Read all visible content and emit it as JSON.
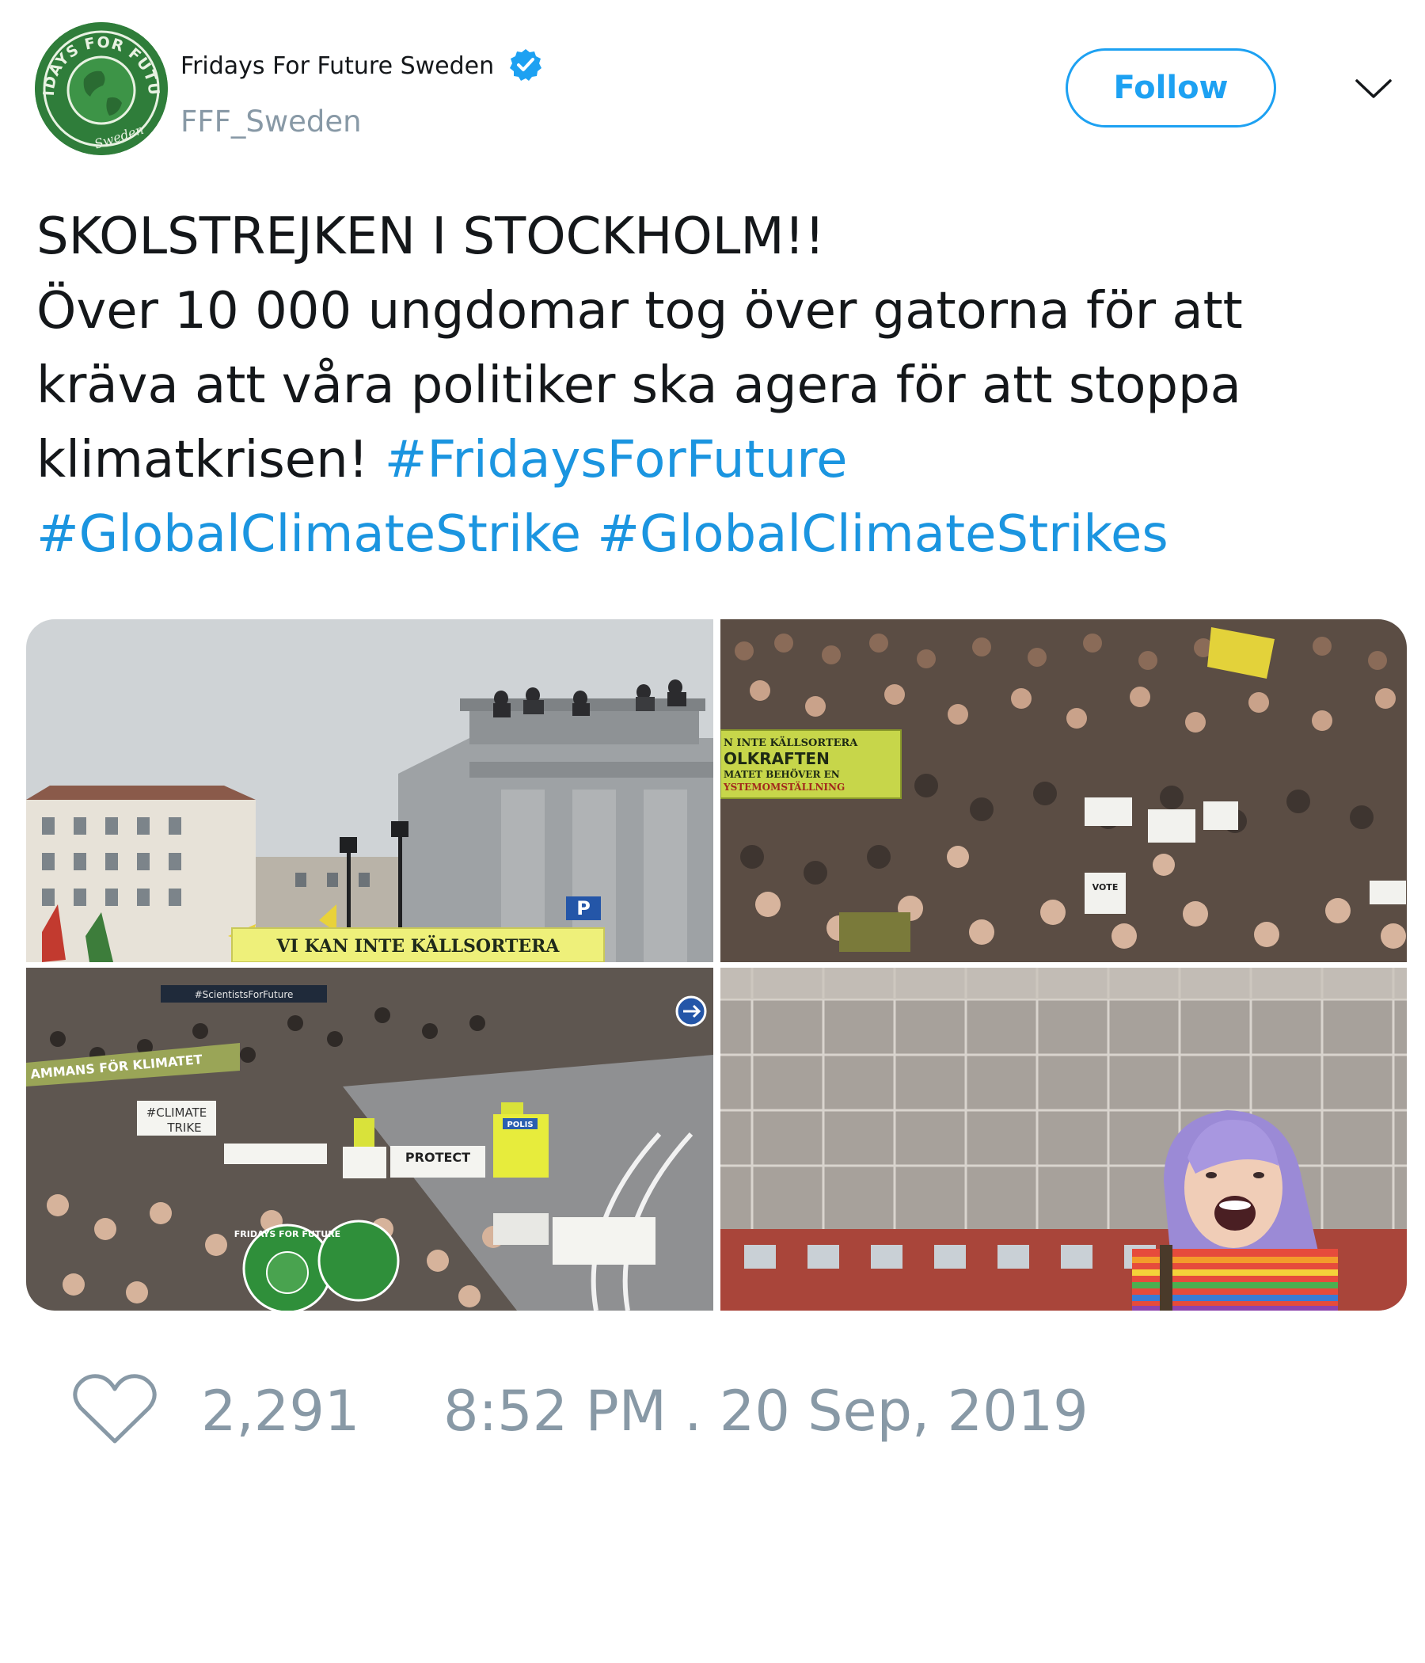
{
  "author": {
    "display_name": "Fridays For Future Sweden",
    "handle": "FFF_Sweden",
    "verified": true,
    "avatar_icon": "fridays-for-future-logo",
    "avatar_ring_text": "FRIDAYS FOR FUTURE",
    "avatar_bottom_text": "Sweden"
  },
  "header": {
    "follow_label": "Follow",
    "menu_icon": "chevron-down-icon"
  },
  "tweet": {
    "line1": "SKOLSTREJKEN I STOCKHOLM!!",
    "line2": "Över 10 000 ungdomar tog över gatorna för att",
    "line3": "kräva att våra politiker ska agera för att stoppa",
    "line4_text": "klimatkrisen! ",
    "hashtags": [
      "#FridaysForFuture",
      "#GlobalClimateStrike",
      "#GlobalClimateStrikes"
    ]
  },
  "photos": {
    "photo1_banner": "VI KAN INTE KÄLLSORTERA",
    "photo1_sign_p": "P",
    "photo2_banner_lines": [
      "N INTE KÄLLSORTERA",
      "OLKRAFTEN",
      "MATET BEHÖVER EN",
      "YSTEMOMSTÄLLNING"
    ],
    "photo2_sign": "VOTE",
    "photo3_banner": "#ScientistsForFuture",
    "photo3_sign_climate": "#CLIMATE",
    "photo3_sign_strike": "TRIKE",
    "photo3_sign_samman": "AMMANS FÖR KLIMATET",
    "photo3_sign_protect": "PROTECT",
    "photo3_sign_polis": "POLIS",
    "photo3_logo_text": "FRIDAYS FOR FUTURE"
  },
  "footer": {
    "like_icon": "heart-icon",
    "like_count": "2,291",
    "timestamp": "8:52 PM . 20 Sep, 2019"
  },
  "colors": {
    "link": "#1b95e0",
    "follow_blue": "#1da1f2",
    "muted": "#8899a6",
    "text": "#14171a",
    "avatar_green": "#2f7d3a"
  }
}
